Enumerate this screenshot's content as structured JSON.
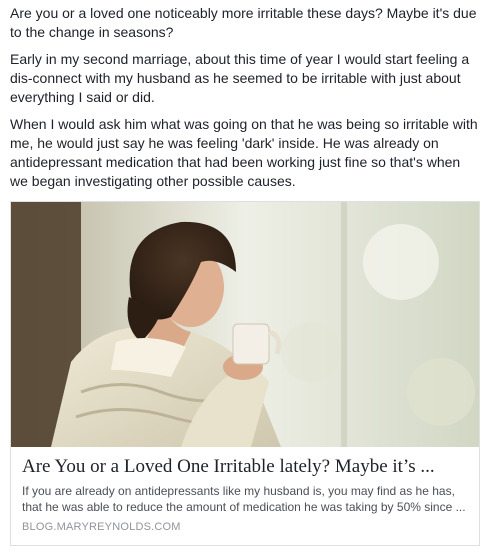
{
  "post": {
    "paragraphs": [
      "Are you or a loved one noticeably more irritable these days? Maybe it's due to the change in seasons?",
      "Early in my second marriage, about this time of year I would start feeling a dis-connect with my husband as he seemed to be irritable with just about everything I said or did.",
      "When I would ask him what was going on that he was being so irritable with me, he would just say he was feeling 'dark' inside. He was already on antidepressant medication that had been working just fine so that's when we began investigating other possible causes."
    ]
  },
  "link_card": {
    "title": "Are You or a Loved One Irritable lately? Maybe it’s ...",
    "description": "If you are already on antidepressants like my husband is, you may find as he has, that he was able to reduce the amount of medication he was taking by 50% since ...",
    "domain": "BLOG.MARYREYNOLDS.COM"
  }
}
